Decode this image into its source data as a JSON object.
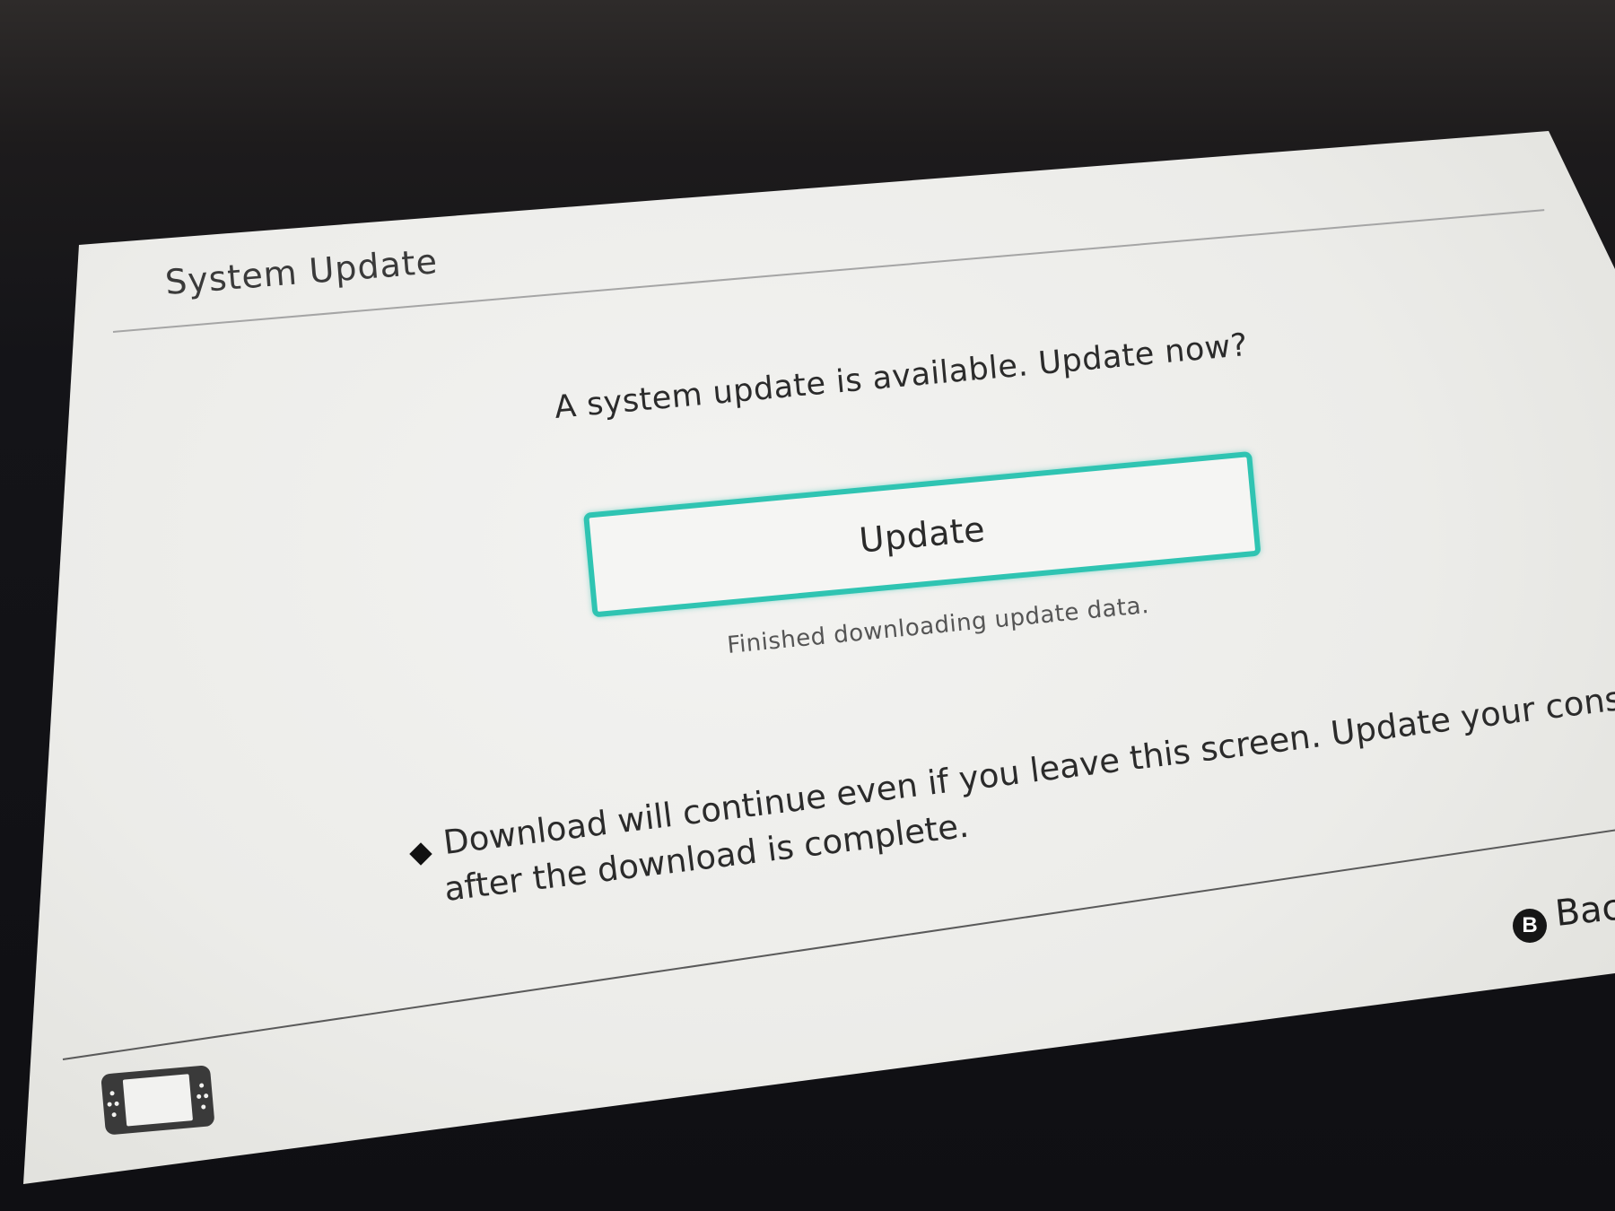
{
  "header": {
    "title": "System Update"
  },
  "main": {
    "question": "A system update is available. Update now?",
    "update_button_label": "Update",
    "status_text": "Finished downloading update data.",
    "note_line1": "Download will continue even if you leave this screen. Update your console",
    "note_line2": "after the download is complete."
  },
  "footer": {
    "back_button_glyph": "B",
    "back_label": "Back",
    "console_icon": "handheld-console-icon"
  },
  "colors": {
    "accent": "#2fc4b2",
    "screen_background": "#ecece9",
    "text": "#2b2b2b"
  }
}
